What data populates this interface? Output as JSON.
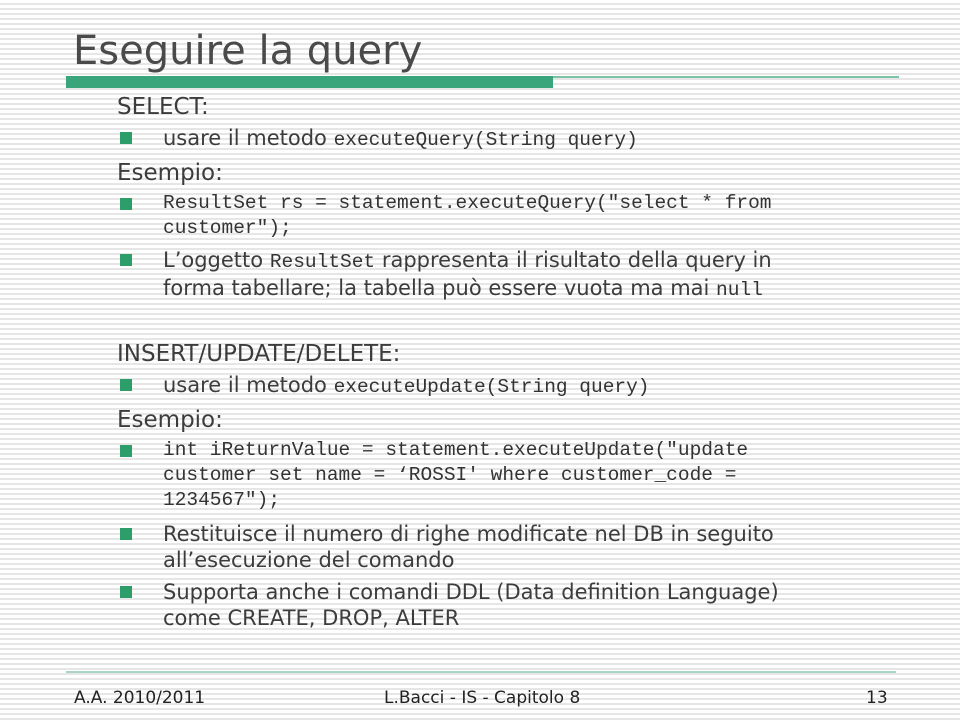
{
  "slide": {
    "title": "Eseguire la query",
    "accent_color": "#3aa57a",
    "sections": {
      "select": {
        "heading": "SELECT:",
        "method_intro": "usare il metodo",
        "method_code": "executeQuery(String query)",
        "example_heading": "Esempio:",
        "example_code_line1": "ResultSet rs = statement.executeQuery(\"select * from",
        "example_code_line2": "customer\");",
        "note_prefix": "L’oggetto",
        "note_code": "ResultSet",
        "note_mid": "rappresenta il risultato della query in",
        "note_line2": "forma tabellare; la tabella può essere vuota ma mai",
        "note_null": "null"
      },
      "update": {
        "heading": "INSERT/UPDATE/DELETE:",
        "method_intro": "usare il metodo",
        "method_code": "executeUpdate(String query)",
        "example_heading": "Esempio:",
        "example_code_line1": "int iReturnValue = statement.executeUpdate(\"update",
        "example_code_line2": "customer set name = ‘ROSSI' where customer_code =",
        "example_code_line3": "1234567\");",
        "note1_line1": "Restituisce il numero di righe modificate nel DB in seguito",
        "note1_line2": "all’esecuzione del comando",
        "note2_line1": "Supporta anche i comandi DDL (Data definition Language)",
        "note2_line2": "come CREATE, DROP, ALTER"
      }
    },
    "footer": {
      "left": "A.A. 2010/2011",
      "center": "L.Bacci - IS - Capitolo 8",
      "page_number": "13"
    }
  }
}
